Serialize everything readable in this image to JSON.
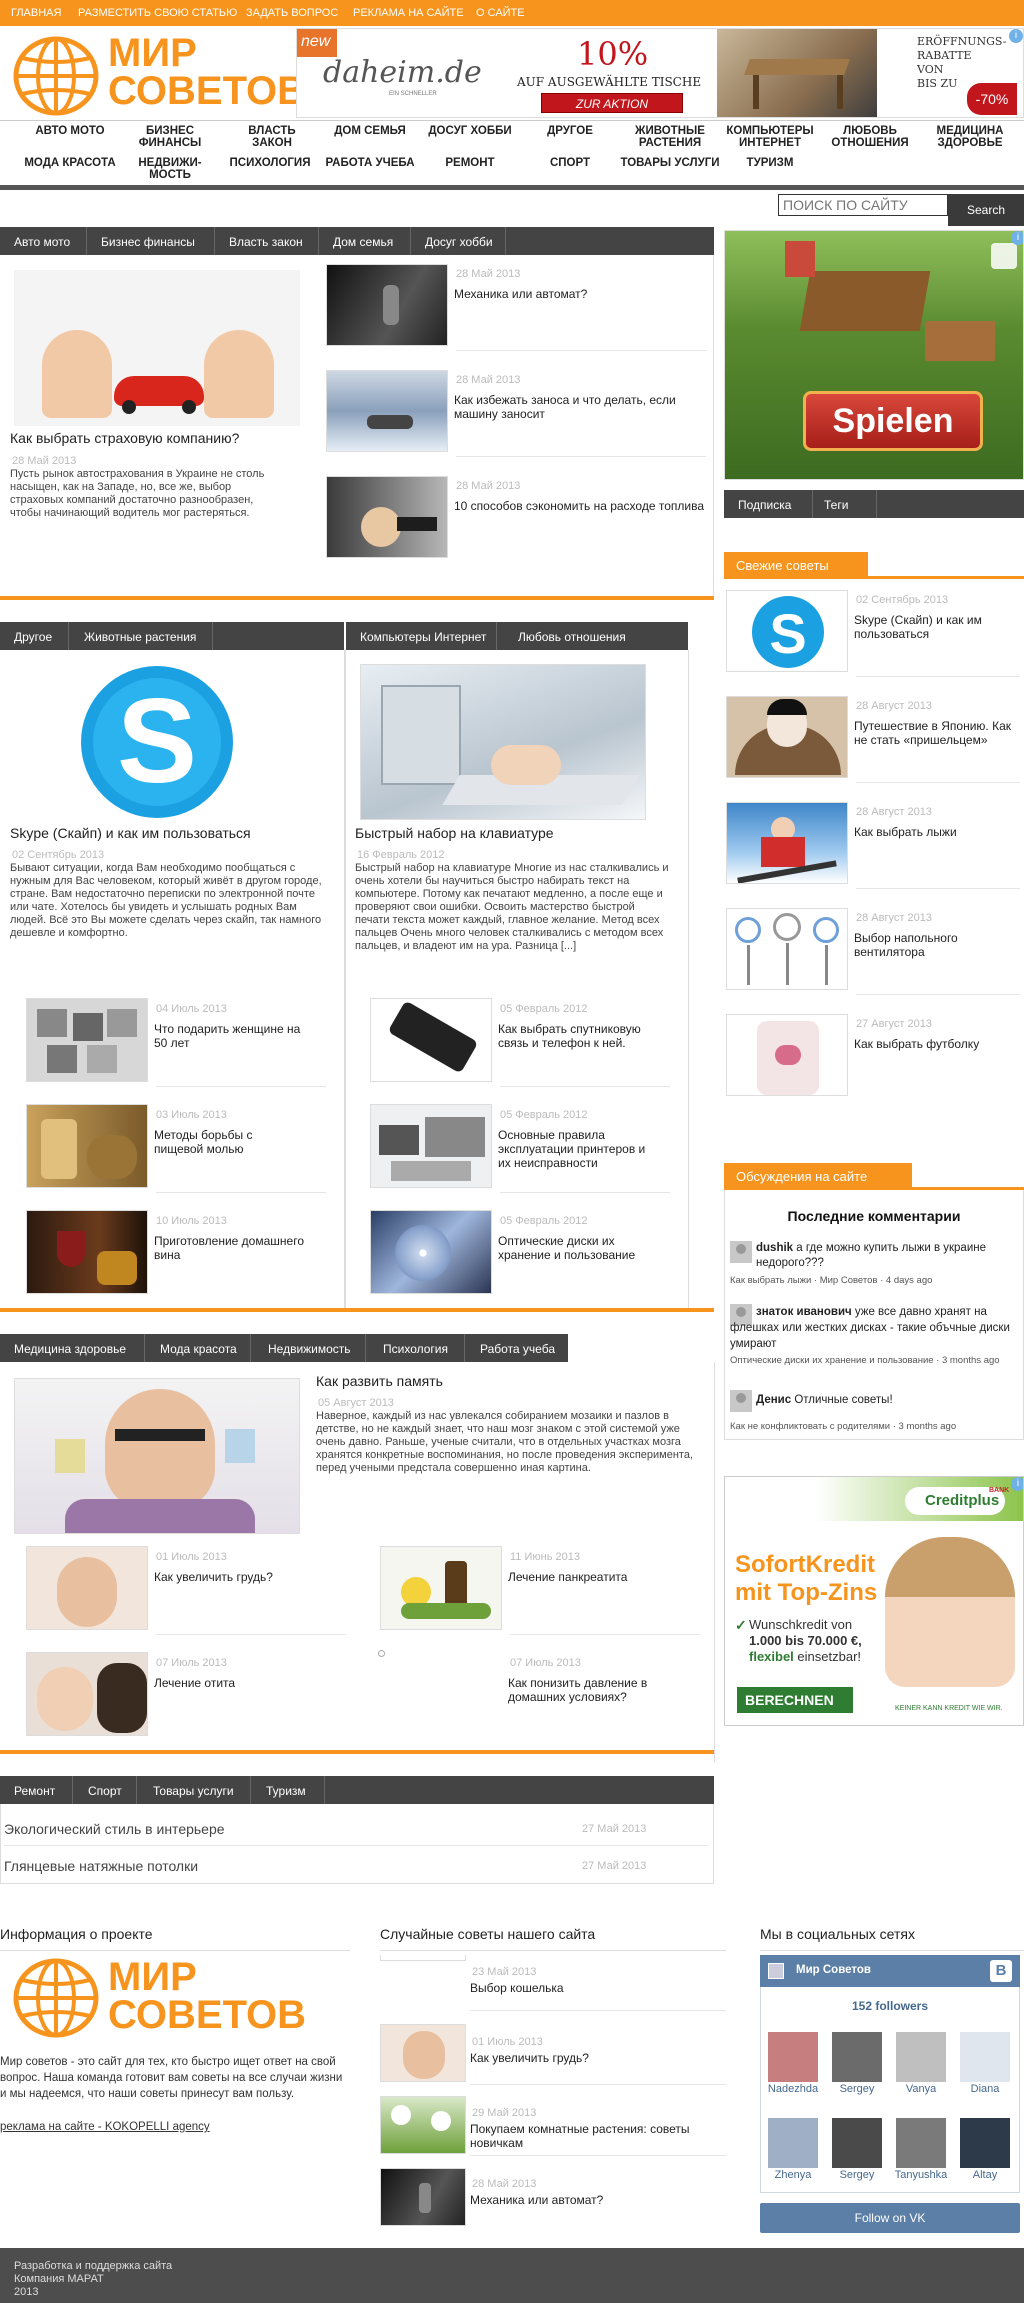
{
  "topbar": {
    "items": [
      "ГЛАВНАЯ",
      "РАЗМЕСТИТЬ СВОЮ СТАТЬЮ",
      "ЗАДАТЬ ВОПРОС",
      "РЕКЛАМА НА САЙТЕ",
      "О САЙТЕ"
    ]
  },
  "logo": {
    "line1": "МИР",
    "line2": "СОВЕТОВ"
  },
  "ad_top": {
    "badge": "new",
    "brand": "daheim.de",
    "brand_sub": "EIN SCHNELLER",
    "percent": "10%",
    "line": "AUF AUSGEWÄHLTE TISCHE",
    "cta": "ZUR AKTION",
    "right1": "ERÖFFNUNGS-",
    "right2": "RABATTE",
    "right3": "VON",
    "right4": "BIS ZU",
    "discount": "-70%"
  },
  "catnav": {
    "row1": [
      "АВТО МОТО",
      "БИЗНЕС ФИНАНСЫ",
      "ВЛАСТЬ ЗАКОН",
      "ДОМ СЕМЬЯ",
      "ДОСУГ ХОББИ",
      "ДРУГОЕ",
      "ЖИВОТНЫЕ РАСТЕНИЯ",
      "КОМПЬЮТЕРЫ ИНТЕРНЕТ",
      "ЛЮБОВЬ ОТНОШЕНИЯ",
      "МЕДИЦИНА ЗДОРОВЬЕ"
    ],
    "row2": [
      "МОДА КРАСОТА",
      "НЕДВИЖИ-МОСТЬ",
      "ПСИХОЛОГИЯ",
      "РАБОТА УЧЕБА",
      "РЕМОНТ",
      "СПОРТ",
      "ТОВАРЫ УСЛУГИ",
      "ТУРИЗМ"
    ]
  },
  "search": {
    "placeholder": "ПОИСК ПО САЙТУ",
    "button": "Search"
  },
  "block1": {
    "tabs": [
      "Авто мото",
      "Бизнес финансы",
      "Власть закон",
      "Дом семья",
      "Досуг хобби"
    ],
    "main": {
      "title": "Как выбрать страховую компанию?",
      "date": "28 Май 2013",
      "desc": "Пусть рынок автострахования в Украине не столь насыщен, как на Западе, но, все же, выбор страховых компаний достаточно разнообразен, чтобы начинающий водитель мог растеряться."
    },
    "items": [
      {
        "date": "28 Май 2013",
        "title": "Механика или автомат?"
      },
      {
        "date": "28 Май 2013",
        "title": "Как избежать заноса и что делать, если машину заносит"
      },
      {
        "date": "28 Май 2013",
        "title": "10 способов сэкономить на расходе топлива"
      }
    ]
  },
  "block2": {
    "tabs_left": [
      "Другое",
      "Животные растения"
    ],
    "tabs_right": [
      "Компьютеры Интернет",
      "Любовь отношения"
    ],
    "left": {
      "title": "Skype (Скайп) и как им пользоваться",
      "date": "02 Сентябрь 2013",
      "desc": "Бывают ситуации, когда Вам необходимо пообщаться с нужным для Вас человеком, который живёт в другом городе, стране. Вам недостаточно переписки по электронной почте или чате. Хотелось бы увидеть и услышать родных Вам людей. Всё это Вы можете сделать через скайп, так намного дешевле и комфортно.",
      "items": [
        {
          "date": "04 Июль 2013",
          "title": "Что подарить женщине на 50 лет"
        },
        {
          "date": "03 Июль 2013",
          "title": "Методы борьбы с пищевой молью"
        },
        {
          "date": "10 Июль 2013",
          "title": "Приготовление домашнего вина"
        }
      ]
    },
    "right": {
      "title": "Быстрый набор на клавиатуре",
      "date": "16 Февраль 2012",
      "desc": "Быстрый набор на клавиатуре Многие из нас сталкивались и очень хотели бы научиться быстро набирать текст на компьютере. Потому как печатают медленно, а после еще и проверяют свои ошибки. Освоить мастерство быстрой печати текста может каждый, главное желание. Метод всех пальцев Очень много человек сталкивались с методом всех пальцев, и владеют им на ура. Разница [...]",
      "items": [
        {
          "date": "05 Февраль 2012",
          "title": "Как выбрать спутниковую связь и телефон к ней."
        },
        {
          "date": "05 Февраль 2012",
          "title": "Основные правила эксплуатации принтеров и их неисправности"
        },
        {
          "date": "05 Февраль 2012",
          "title": "Оптические диски их хранение и пользование"
        }
      ]
    }
  },
  "block3": {
    "tabs": [
      "Медицина здоровье",
      "Мода красота",
      "Недвижимость",
      "Психология",
      "Работа учеба"
    ],
    "main": {
      "title": "Как развить память",
      "date": "05 Август 2013",
      "desc": "Наверное, каждый из нас увлекался собиранием мозаики и пазлов в детстве, но не каждый знает, что наш мозг знаком с этой системой уже очень давно. Раньше, ученые считали, что в отдельных участках мозга хранятся конкретные воспоминания, но после проведения эксперимента, перед учеными предстала совершенно иная картина."
    },
    "items": [
      {
        "date": "01 Июль 2013",
        "title": "Как увеличить грудь?"
      },
      {
        "date": "11 Июнь 2013",
        "title": "Лечение панкреатита"
      },
      {
        "date": "07 Июль 2013",
        "title": "Лечение отита"
      },
      {
        "date": "07 Июль 2013",
        "title": "Как понизить давление в домашних условиях?"
      }
    ]
  },
  "block4": {
    "tabs": [
      "Ремонт",
      "Спорт",
      "Товары услуги",
      "Туризм"
    ],
    "items": [
      {
        "title": "Экологический стиль в интерьере",
        "date": "27 Май 2013"
      },
      {
        "title": "Глянцевые натяжные потолки",
        "date": "27 Май 2013"
      }
    ]
  },
  "sidebar": {
    "game_cta": "Spielen",
    "tabs": [
      "Подписка",
      "Теги"
    ],
    "fresh_title": "Свежие советы",
    "fresh": [
      {
        "date": "02 Сентябрь 2013",
        "title": "Skype (Скайп) и как им пользоваться"
      },
      {
        "date": "28 Август 2013",
        "title": "Путешествие в Японию. Как не стать «пришельцем»"
      },
      {
        "date": "28 Август 2013",
        "title": "Как выбрать лыжи"
      },
      {
        "date": "28 Август 2013",
        "title": "Выбор напольного вентилятора"
      },
      {
        "date": "27 Август 2013",
        "title": "Как выбрать футболку"
      }
    ],
    "disc_title": "Обсуждения на сайте",
    "last_comments": "Последние комментарии",
    "comments": [
      {
        "author": "dushik",
        "text": "а где можно купить лыжи в украине недорого???",
        "meta": "Как выбрать лыжи · Мир Советов · 4 days ago"
      },
      {
        "author": "знаток иванович",
        "text": "уже все давно хранят на флешках или жестких дисках - такие объчные диски умирают",
        "meta": "Оптические диски их хранение и пользование · 3 months ago"
      },
      {
        "author": "Денис",
        "text": "Отличные советы!",
        "meta": "Как не конфликтовать с родителями · 3 months ago"
      }
    ],
    "ad2": {
      "brand": "Creditplus",
      "bank": "BANK",
      "head1": "SofortKredit",
      "head2": "mit Top-Zins",
      "check": "Wunschkredit von",
      "amount": "1.000 bis 70.000 €,",
      "flex": "flexibel",
      "flex2": "einsetzbar!",
      "btn": "BERECHNEN",
      "foot": "KEINER KANN KREDIT WIE WIR."
    }
  },
  "footer": {
    "info_title": "Информация о проекте",
    "info_text": "Мир советов - это сайт для тех, кто быстро ищет ответ на свой вопрос. Наша команда готовит вам советы на все случаи жизни и мы надеемся, что наши советы принесут вам пользу.",
    "info_link": "реклама на сайте - KOKOPELLI agency",
    "random_title": "Случайные советы нашего сайта",
    "random": [
      {
        "date": "23 Май 2013",
        "title": "Выбор кошелька"
      },
      {
        "date": "01 Июль 2013",
        "title": "Как увеличить грудь?"
      },
      {
        "date": "29 Май 2013",
        "title": "Покупаем комнатные растения: советы новичкам"
      },
      {
        "date": "28 Май 2013",
        "title": "Механика или автомат?"
      }
    ],
    "social_title": "Мы в социальных сетях",
    "vk_name": "Мир Советов",
    "vk_followers": "152 followers",
    "vk_members": [
      "Nadezhda",
      "Sergey",
      "Vanya",
      "Diana",
      "Zhenya",
      "Sergey",
      "Tanyushka",
      "Altay"
    ],
    "vk_follow": "Follow on VK",
    "bottom1": "Разработка и поддержка сайта",
    "bottom2": "Компания МАРАТ",
    "bottom3": "2013"
  }
}
